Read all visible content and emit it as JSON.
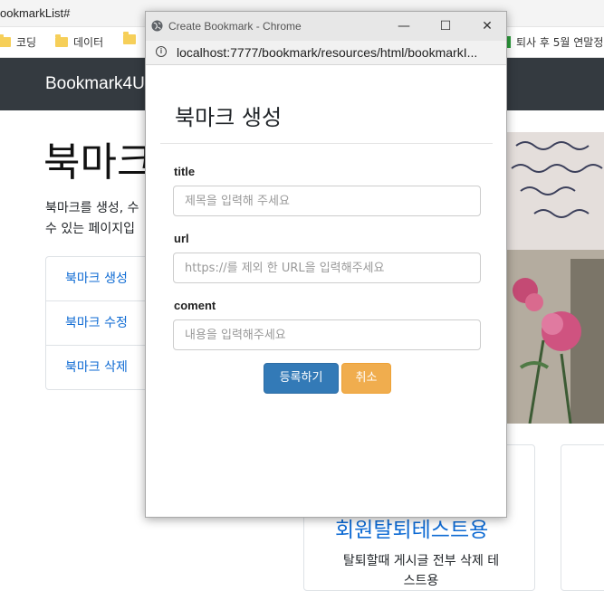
{
  "background": {
    "tab_title": "ookmarkList#",
    "bookmarks": [
      {
        "label": "코딩"
      },
      {
        "label": "데이터"
      },
      {
        "label": ""
      }
    ],
    "bookmark_right": "퇴사 후 5월 연말정",
    "brand": "Bookmark4U",
    "heading": "북마크",
    "description_line1": "북마크를 생성, 수",
    "description_line2": "수 있는 페이지입",
    "menu": [
      {
        "label": "북마크 생성"
      },
      {
        "label": "북마크 수정"
      },
      {
        "label": "북마크 삭제"
      }
    ],
    "card": {
      "title": "회원탈퇴테스트용",
      "text_line1": "탈퇴할때 게시글 전부 삭제 테",
      "text_line2": "스트용"
    }
  },
  "popup": {
    "window_title": "Create Bookmark - Chrome",
    "url": "localhost:7777/bookmark/resources/html/bookmarkI...",
    "modal_title": "북마크 생성",
    "fields": {
      "title": {
        "label": "title",
        "placeholder": "제목을 입력해 주세요",
        "value": ""
      },
      "url": {
        "label": "url",
        "placeholder": "https://를 제외 한 URL을 입력해주세요",
        "value": ""
      },
      "coment": {
        "label": "coment",
        "placeholder": "내용을 입력해주세요",
        "value": ""
      }
    },
    "buttons": {
      "submit": "등록하기",
      "cancel": "취소"
    },
    "window_controls": {
      "minimize": "—",
      "maximize": "☐",
      "close": "✕"
    }
  },
  "colors": {
    "navbar": "#343a40",
    "link": "#0d6ad3",
    "primary_button": "#337ab7",
    "warning_button": "#f0ad4e"
  }
}
